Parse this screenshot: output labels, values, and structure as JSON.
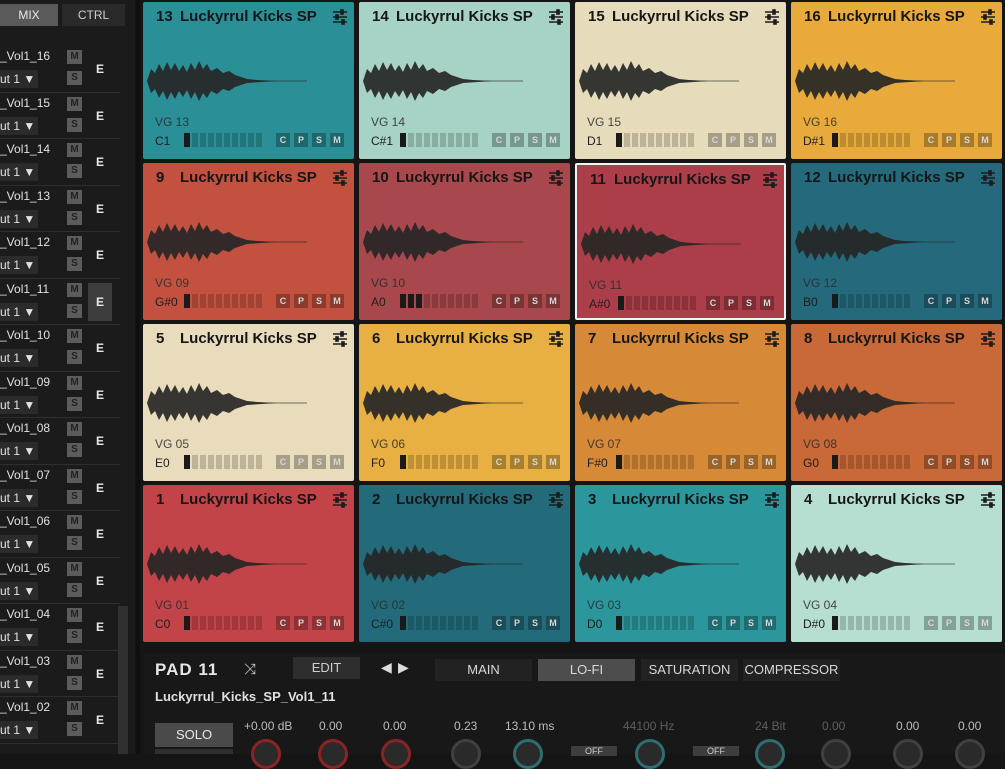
{
  "left_panel": {
    "tabs": [
      {
        "label": "MIX",
        "active": true
      },
      {
        "label": "CTRL",
        "active": false
      }
    ],
    "rows": [
      {
        "name": "_Vol1_16",
        "output": "ut 1 ▼",
        "m": "M",
        "s": "S",
        "e": "E",
        "selected": false
      },
      {
        "name": "_Vol1_15",
        "output": "ut 1 ▼",
        "m": "M",
        "s": "S",
        "e": "E",
        "selected": false
      },
      {
        "name": "_Vol1_14",
        "output": "ut 1 ▼",
        "m": "M",
        "s": "S",
        "e": "E",
        "selected": false
      },
      {
        "name": "_Vol1_13",
        "output": "ut 1 ▼",
        "m": "M",
        "s": "S",
        "e": "E",
        "selected": false
      },
      {
        "name": "_Vol1_12",
        "output": "ut 1 ▼",
        "m": "M",
        "s": "S",
        "e": "E",
        "selected": false
      },
      {
        "name": "_Vol1_11",
        "output": "ut 1 ▼",
        "m": "M",
        "s": "S",
        "e": "E",
        "selected": true
      },
      {
        "name": "_Vol1_10",
        "output": "ut 1 ▼",
        "m": "M",
        "s": "S",
        "e": "E",
        "selected": false
      },
      {
        "name": "_Vol1_09",
        "output": "ut 1 ▼",
        "m": "M",
        "s": "S",
        "e": "E",
        "selected": false
      },
      {
        "name": "_Vol1_08",
        "output": "ut 1 ▼",
        "m": "M",
        "s": "S",
        "e": "E",
        "selected": false
      },
      {
        "name": "_Vol1_07",
        "output": "ut 1 ▼",
        "m": "M",
        "s": "S",
        "e": "E",
        "selected": false
      },
      {
        "name": "_Vol1_06",
        "output": "ut 1 ▼",
        "m": "M",
        "s": "S",
        "e": "E",
        "selected": false
      },
      {
        "name": "_Vol1_05",
        "output": "ut 1 ▼",
        "m": "M",
        "s": "S",
        "e": "E",
        "selected": false
      },
      {
        "name": "_Vol1_04",
        "output": "ut 1 ▼",
        "m": "M",
        "s": "S",
        "e": "E",
        "selected": false
      },
      {
        "name": "_Vol1_03",
        "output": "ut 1 ▼",
        "m": "M",
        "s": "S",
        "e": "E",
        "selected": false
      },
      {
        "name": "_Vol1_02",
        "output": "ut 1 ▼",
        "m": "M",
        "s": "S",
        "e": "E",
        "selected": false
      }
    ]
  },
  "pads": [
    {
      "num": "13",
      "title": "Luckyrrul Kicks SP",
      "group": "VG 13",
      "note": "C1",
      "color": "#2a8f97",
      "selected": false,
      "meter_lit": 1
    },
    {
      "num": "14",
      "title": "Luckyrrul Kicks SP",
      "group": "VG 14",
      "note": "C#1",
      "color": "#a6d3c5",
      "selected": false,
      "meter_lit": 1
    },
    {
      "num": "15",
      "title": "Luckyrrul Kicks SP",
      "group": "VG 15",
      "note": "D1",
      "color": "#e6dcbb",
      "selected": false,
      "meter_lit": 1
    },
    {
      "num": "16",
      "title": "Luckyrrul Kicks SP",
      "group": "VG 16",
      "note": "D#1",
      "color": "#e8ab3b",
      "selected": false,
      "meter_lit": 1
    },
    {
      "num": "9",
      "title": "Luckyrrul Kicks SP",
      "group": "VG 09",
      "note": "G#0",
      "color": "#c2523f",
      "selected": false,
      "meter_lit": 1
    },
    {
      "num": "10",
      "title": "Luckyrrul Kicks SP",
      "group": "VG 10",
      "note": "A0",
      "color": "#a8484c",
      "selected": false,
      "meter_lit": 3
    },
    {
      "num": "11",
      "title": "Luckyrrul Kicks SP",
      "group": "VG 11",
      "note": "A#0",
      "color": "#ab3e49",
      "selected": true,
      "meter_lit": 1
    },
    {
      "num": "12",
      "title": "Luckyrrul Kicks SP",
      "group": "VG 12",
      "note": "B0",
      "color": "#246a7c",
      "selected": false,
      "meter_lit": 1
    },
    {
      "num": "5",
      "title": "Luckyrrul Kicks SP",
      "group": "VG 05",
      "note": "E0",
      "color": "#e8dcbc",
      "selected": false,
      "meter_lit": 1
    },
    {
      "num": "6",
      "title": "Luckyrrul Kicks SP",
      "group": "VG 06",
      "note": "F0",
      "color": "#e8b042",
      "selected": false,
      "meter_lit": 1
    },
    {
      "num": "7",
      "title": "Luckyrrul Kicks SP",
      "group": "VG 07",
      "note": "F#0",
      "color": "#d68937",
      "selected": false,
      "meter_lit": 1
    },
    {
      "num": "8",
      "title": "Luckyrrul Kicks SP",
      "group": "VG 08",
      "note": "G0",
      "color": "#c86937",
      "selected": false,
      "meter_lit": 1
    },
    {
      "num": "1",
      "title": "Luckyrrul Kicks SP",
      "group": "VG 01",
      "note": "C0",
      "color": "#c24448",
      "selected": false,
      "meter_lit": 1
    },
    {
      "num": "2",
      "title": "Luckyrrul Kicks SP",
      "group": "VG 02",
      "note": "C#0",
      "color": "#236b7b",
      "selected": false,
      "meter_lit": 1
    },
    {
      "num": "3",
      "title": "Luckyrrul Kicks SP",
      "group": "VG 03",
      "note": "D0",
      "color": "#2b969b",
      "selected": false,
      "meter_lit": 1
    },
    {
      "num": "4",
      "title": "Luckyrrul Kicks SP",
      "group": "VG 04",
      "note": "D#0",
      "color": "#b7dfd1",
      "selected": false,
      "meter_lit": 1
    }
  ],
  "pad_buttons": [
    "C",
    "P",
    "S",
    "M"
  ],
  "pad_icon": "sliders-icon",
  "bottom": {
    "pad_label": "PAD 11",
    "edit_label": "EDIT",
    "tabs": [
      {
        "label": "MAIN",
        "active": false
      },
      {
        "label": "LO-FI",
        "active": true
      },
      {
        "label": "SATURATION",
        "active": false
      },
      {
        "label": "COMPRESSOR",
        "active": false
      }
    ],
    "sample_name": "Luckyrrul_Kicks_SP_Vol1_11",
    "solo_label": "SOLO",
    "params": [
      {
        "value": "+0.00 dB",
        "dim": false
      },
      {
        "value": "0.00",
        "dim": false
      },
      {
        "value": "0.00",
        "dim": false
      },
      {
        "value": "0.23",
        "dim": false
      },
      {
        "value": "13.10 ms",
        "dim": false
      },
      {
        "value": "44100 Hz",
        "dim": true
      },
      {
        "value": "24 Bit",
        "dim": true
      },
      {
        "value": "0.00",
        "dim": true
      },
      {
        "value": "0.00",
        "dim": false
      },
      {
        "value": "0.00",
        "dim": false
      }
    ],
    "off_labels": [
      "OFF",
      "OFF"
    ]
  }
}
